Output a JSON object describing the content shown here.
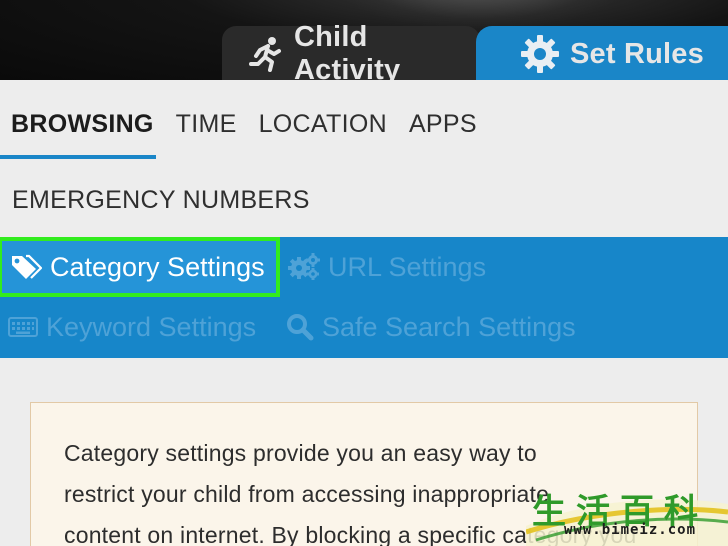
{
  "header": {
    "tabs": [
      {
        "label": "Child Activity",
        "icon": "running-person-icon",
        "active": false
      },
      {
        "label": "Set Rules",
        "icon": "gear-icon",
        "active": true
      }
    ]
  },
  "nav": {
    "items": [
      {
        "label": "BROWSING",
        "active": true
      },
      {
        "label": "TIME",
        "active": false
      },
      {
        "label": "LOCATION",
        "active": false
      },
      {
        "label": "APPS",
        "active": false
      },
      {
        "label": "EMERGENCY NUMBERS",
        "active": false
      }
    ]
  },
  "settings": {
    "items": [
      {
        "label": "Category Settings",
        "icon": "tag-icon",
        "active": true,
        "highlighted": true
      },
      {
        "label": "URL Settings",
        "icon": "cogs-icon",
        "active": false
      },
      {
        "label": "Keyword Settings",
        "icon": "keyboard-icon",
        "active": false
      },
      {
        "label": "Safe Search Settings",
        "icon": "search-icon",
        "active": false
      }
    ]
  },
  "info": {
    "lines": [
      "Category settings provide you an easy way to",
      "restrict your child from accessing inappropriate",
      "content on internet. By blocking a specific category you"
    ]
  },
  "watermark": {
    "chars": "生活百科",
    "url": "www.bimeiz.com"
  },
  "colors": {
    "accent_blue": "#1786c9",
    "highlight_green": "#32ec1e",
    "card_background": "#fbf5ea"
  }
}
